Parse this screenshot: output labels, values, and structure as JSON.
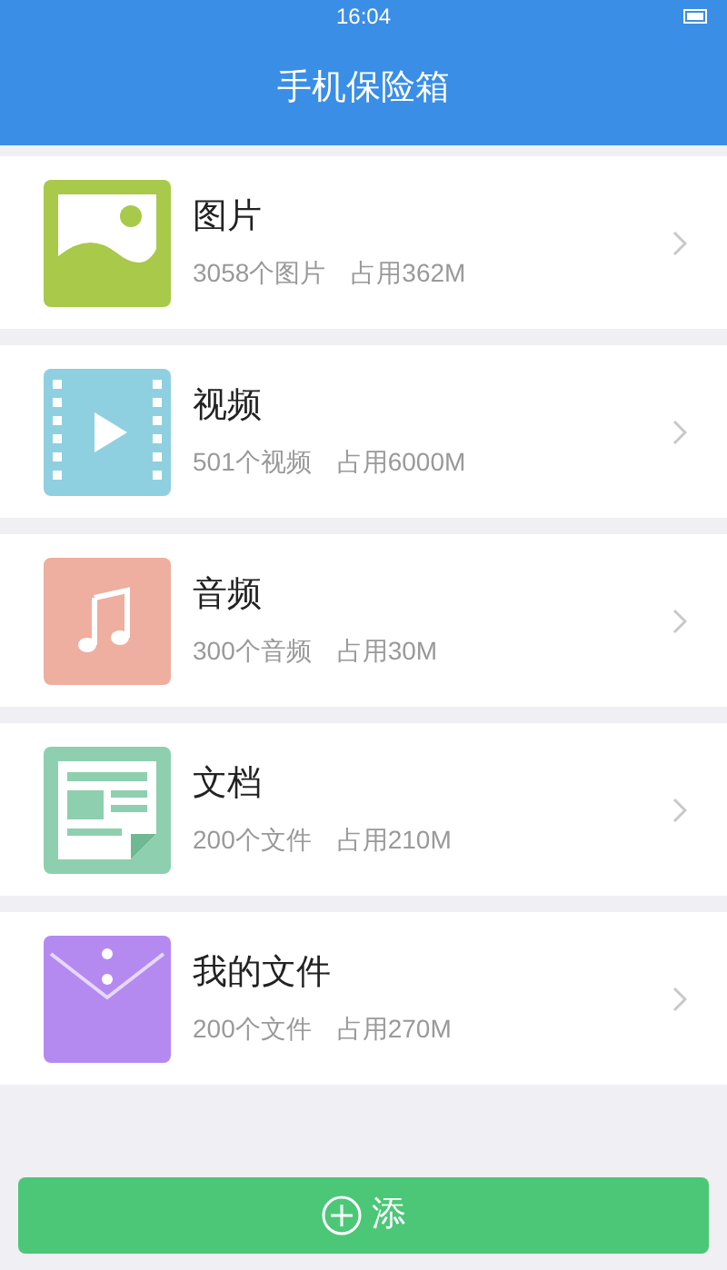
{
  "status_bar": {
    "time": "16:04"
  },
  "header": {
    "title": "手机保险箱"
  },
  "items": [
    {
      "kind": "image",
      "name": "图片",
      "count": "3058个图片",
      "usage": "占用362M"
    },
    {
      "kind": "video",
      "name": "视频",
      "count": "501个视频",
      "usage": "占用6000M"
    },
    {
      "kind": "audio",
      "name": "音频",
      "count": "300个音频",
      "usage": "占用30M"
    },
    {
      "kind": "document",
      "name": "文档",
      "count": "200个文件",
      "usage": "占用210M"
    },
    {
      "kind": "folder",
      "name": "我的文件",
      "count": "200个文件",
      "usage": "占用270M"
    }
  ],
  "add_button": {
    "label": "添"
  }
}
